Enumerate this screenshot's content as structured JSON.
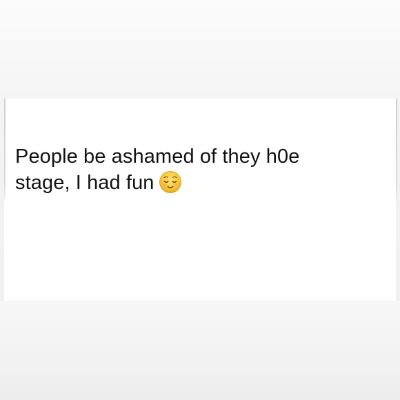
{
  "tweet": {
    "line1": "People be ashamed of they h0e",
    "line2": "stage, I had fun",
    "emoji": "relieved-face-icon"
  },
  "colors": {
    "text": "#111111",
    "card": "#ffffff",
    "background": "#f2f2f2",
    "emoji_face": "#f7c93b"
  }
}
